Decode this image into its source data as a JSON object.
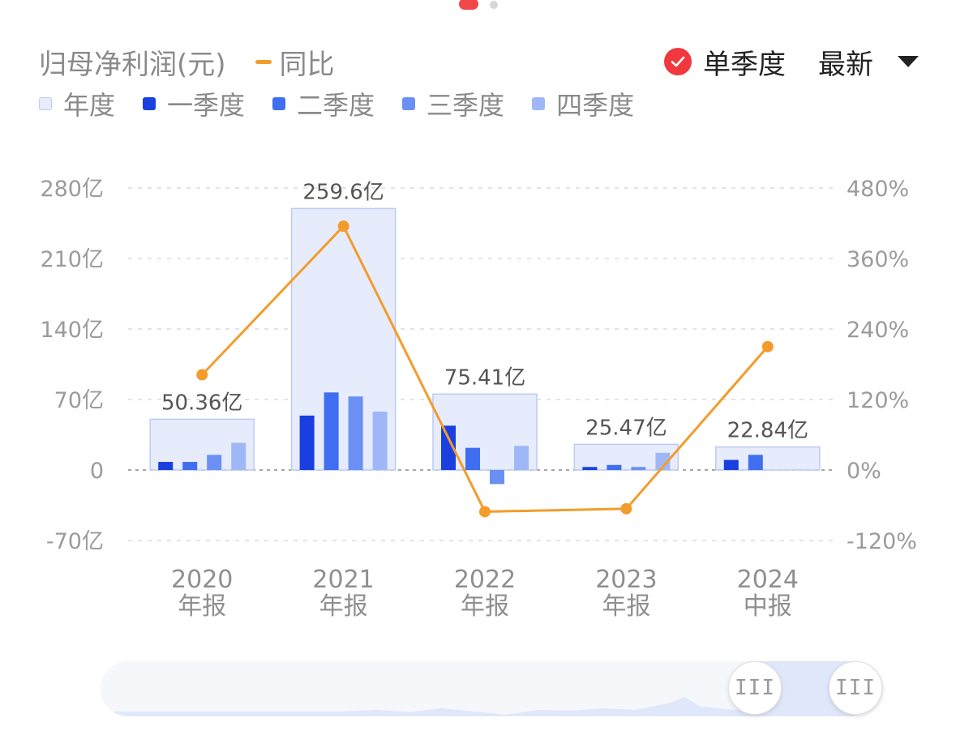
{
  "header": {
    "title": "归母净利润(元)",
    "yoy_label": "同比",
    "single_quarter_label": "单季度",
    "latest_label": "最新"
  },
  "legend": [
    {
      "label": "年度",
      "color": "#e6ecfb"
    },
    {
      "label": "一季度",
      "color": "#1a3fe0"
    },
    {
      "label": "二季度",
      "color": "#3f6ef0"
    },
    {
      "label": "三季度",
      "color": "#6a90f3"
    },
    {
      "label": "四季度",
      "color": "#9fb7f7"
    }
  ],
  "colors": {
    "accent_red": "#f0383e",
    "yoy_line": "#f39c2b",
    "annual_fill": "#e6ecfb",
    "annual_border": "#bccbf3"
  },
  "chart_data": {
    "type": "bar",
    "categories": [
      [
        "2020",
        "年报"
      ],
      [
        "2021",
        "年报"
      ],
      [
        "2022",
        "年报"
      ],
      [
        "2023",
        "年报"
      ],
      [
        "2024",
        "中报"
      ]
    ],
    "y_left_ticks": [
      "280亿",
      "210亿",
      "140亿",
      "70亿",
      "0",
      "-70亿"
    ],
    "y_right_ticks": [
      "480%",
      "360%",
      "240%",
      "120%",
      "0%",
      "-120%"
    ],
    "ylim_left": [
      -70,
      280
    ],
    "ylim_right": [
      -120,
      480
    ],
    "annual": [
      50.36,
      259.6,
      75.41,
      25.47,
      22.84
    ],
    "annual_labels": [
      "50.36亿",
      "259.6亿",
      "75.41亿",
      "25.47亿",
      "22.84亿"
    ],
    "series": [
      {
        "name": "一季度",
        "values": [
          8,
          54,
          44,
          3,
          10
        ]
      },
      {
        "name": "二季度",
        "values": [
          8,
          77,
          22,
          5,
          15
        ]
      },
      {
        "name": "三季度",
        "values": [
          15,
          73,
          -14,
          3,
          null
        ]
      },
      {
        "name": "四季度",
        "values": [
          27,
          58,
          24,
          17,
          null
        ]
      }
    ],
    "yoy": {
      "name": "同比",
      "values": [
        162,
        415,
        -71,
        -66,
        210
      ]
    },
    "grid": true
  }
}
